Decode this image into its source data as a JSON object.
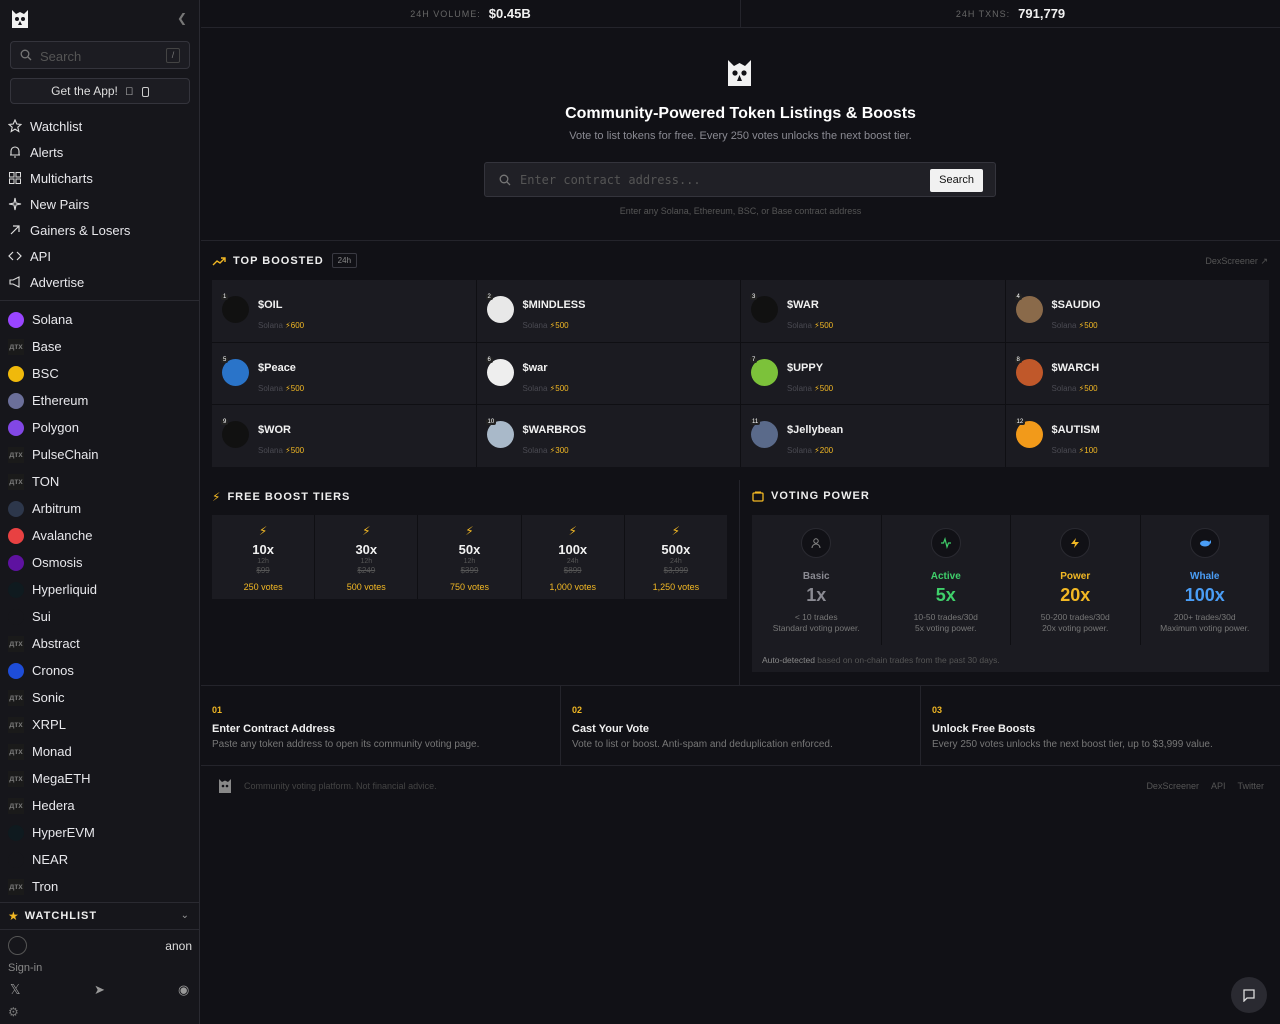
{
  "sidebar": {
    "search": {
      "placeholder": "Search",
      "kbd": "/"
    },
    "get_app": "Get the App!",
    "nav": [
      {
        "label": "Watchlist",
        "icon": "star-icon"
      },
      {
        "label": "Alerts",
        "icon": "bell-icon"
      },
      {
        "label": "Multicharts",
        "icon": "grid-icon"
      },
      {
        "label": "New Pairs",
        "icon": "sparkle-icon"
      },
      {
        "label": "Gainers & Losers",
        "icon": "arrow-up-right-icon"
      },
      {
        "label": "API",
        "icon": "code-icon"
      },
      {
        "label": "Advertise",
        "icon": "megaphone-icon"
      }
    ],
    "chains": [
      {
        "label": "Solana",
        "color": "#9945ff",
        "glyph": ""
      },
      {
        "label": "Base",
        "color": "#1a1a1a",
        "glyph": "дтх"
      },
      {
        "label": "BSC",
        "color": "#f0b90b",
        "glyph": ""
      },
      {
        "label": "Ethereum",
        "color": "#6b6f9a",
        "glyph": ""
      },
      {
        "label": "Polygon",
        "color": "#8247e5",
        "glyph": ""
      },
      {
        "label": "PulseChain",
        "color": "#1a1a1a",
        "glyph": "дтх"
      },
      {
        "label": "TON",
        "color": "#1a1a1a",
        "glyph": "дтх"
      },
      {
        "label": "Arbitrum",
        "color": "#2d374b",
        "glyph": ""
      },
      {
        "label": "Avalanche",
        "color": "#e84142",
        "glyph": ""
      },
      {
        "label": "Osmosis",
        "color": "#5e12a0",
        "glyph": ""
      },
      {
        "label": "Hyperliquid",
        "color": "#0f1a1f",
        "glyph": ""
      },
      {
        "label": "Sui",
        "color": "#16161b",
        "glyph": ""
      },
      {
        "label": "Abstract",
        "color": "#1a1a1a",
        "glyph": "дтх"
      },
      {
        "label": "Cronos",
        "color": "#1e4dd8",
        "glyph": ""
      },
      {
        "label": "Sonic",
        "color": "#1a1a1a",
        "glyph": "дтх"
      },
      {
        "label": "XRPL",
        "color": "#1a1a1a",
        "glyph": "дтх"
      },
      {
        "label": "Monad",
        "color": "#1a1a1a",
        "glyph": "дтх"
      },
      {
        "label": "MegaETH",
        "color": "#1a1a1a",
        "glyph": "дтх"
      },
      {
        "label": "Hedera",
        "color": "#1a1a1a",
        "glyph": "дтх"
      },
      {
        "label": "HyperEVM",
        "color": "#0f1a1f",
        "glyph": ""
      },
      {
        "label": "NEAR",
        "color": "#16161b",
        "glyph": ""
      },
      {
        "label": "Tron",
        "color": "#1a1a1a",
        "glyph": "дтх"
      }
    ],
    "watchlist_title": "WATCHLIST",
    "user_name": "anon",
    "sign_in": "Sign-in"
  },
  "stats": [
    {
      "label": "24H VOLUME:",
      "value": "$0.45B"
    },
    {
      "label": "24H TXNS:",
      "value": "791,779"
    }
  ],
  "hero": {
    "title": "Community-Powered Token Listings & Boosts",
    "subtitle": "Vote to list tokens for free. Every 250 votes unlocks the next boost tier.",
    "input_placeholder": "Enter contract address...",
    "search_button": "Search",
    "hint": "Enter any Solana, Ethereum, BSC, or Base contract address"
  },
  "top_boosted": {
    "title": "TOP BOOSTED",
    "pill": "24h",
    "link": "DexScreener",
    "tokens": [
      {
        "rank": "1",
        "symbol": "$OIL",
        "chain": "Solana",
        "boost": "600",
        "color": "#111"
      },
      {
        "rank": "2",
        "symbol": "$MINDLESS",
        "chain": "Solana",
        "boost": "500",
        "color": "#e8e8e8"
      },
      {
        "rank": "3",
        "symbol": "$WAR",
        "chain": "Solana",
        "boost": "500",
        "color": "#111"
      },
      {
        "rank": "4",
        "symbol": "$SAUDIO",
        "chain": "Solana",
        "boost": "500",
        "color": "#8a6a4a"
      },
      {
        "rank": "5",
        "symbol": "$Peace",
        "chain": "Solana",
        "boost": "500",
        "color": "#2a74c9"
      },
      {
        "rank": "6",
        "symbol": "$war",
        "chain": "Solana",
        "boost": "500",
        "color": "#eeeeee"
      },
      {
        "rank": "7",
        "symbol": "$UPPY",
        "chain": "Solana",
        "boost": "500",
        "color": "#7cc23a"
      },
      {
        "rank": "8",
        "symbol": "$WARCH",
        "chain": "Solana",
        "boost": "500",
        "color": "#c0582a"
      },
      {
        "rank": "9",
        "symbol": "$WOR",
        "chain": "Solana",
        "boost": "500",
        "color": "#111"
      },
      {
        "rank": "10",
        "symbol": "$WARBROS",
        "chain": "Solana",
        "boost": "300",
        "color": "#a9b9c9"
      },
      {
        "rank": "11",
        "symbol": "$Jellybean",
        "chain": "Solana",
        "boost": "200",
        "color": "#5a6a8a"
      },
      {
        "rank": "12",
        "symbol": "$AUTISM",
        "chain": "Solana",
        "boost": "100",
        "color": "#f29a1a"
      }
    ]
  },
  "free_boost": {
    "title": "FREE BOOST TIERS",
    "tiers": [
      {
        "mult": "10x",
        "dur": "12h",
        "price": "$99",
        "votes": "250 votes"
      },
      {
        "mult": "30x",
        "dur": "12h",
        "price": "$249",
        "votes": "500 votes"
      },
      {
        "mult": "50x",
        "dur": "12h",
        "price": "$399",
        "votes": "750 votes"
      },
      {
        "mult": "100x",
        "dur": "24h",
        "price": "$899",
        "votes": "1,000 votes"
      },
      {
        "mult": "500x",
        "dur": "24h",
        "price": "$3,999",
        "votes": "1,250 votes"
      }
    ]
  },
  "voting_power": {
    "title": "VOTING POWER",
    "levels": [
      {
        "name": "Basic",
        "mult": "1x",
        "d1": "< 10 trades",
        "d2": "Standard voting power.",
        "color": "#8a8a92",
        "icon": "user-icon"
      },
      {
        "name": "Active",
        "mult": "5x",
        "d1": "10-50 trades/30d",
        "d2": "5x voting power.",
        "color": "#3fcf6a",
        "icon": "activity-icon"
      },
      {
        "name": "Power",
        "mult": "20x",
        "d1": "50-200 trades/30d",
        "d2": "20x voting power.",
        "color": "#f2b824",
        "icon": "bolt-icon"
      },
      {
        "name": "Whale",
        "mult": "100x",
        "d1": "200+ trades/30d",
        "d2": "Maximum voting power.",
        "color": "#4a9df5",
        "icon": "whale-icon"
      }
    ],
    "footer_bold": "Auto-detected",
    "footer_rest": " based on on-chain trades from the past 30 days."
  },
  "steps": [
    {
      "num": "01",
      "title": "Enter Contract Address",
      "text": "Paste any token address to open its community voting page."
    },
    {
      "num": "02",
      "title": "Cast Your Vote",
      "text": "Vote to list or boost. Anti-spam and deduplication enforced."
    },
    {
      "num": "03",
      "title": "Unlock Free Boosts",
      "text": "Every 250 votes unlocks the next boost tier, up to $3,999 value."
    }
  ],
  "footer": {
    "text": "Community voting platform. Not financial advice.",
    "links": [
      "DexScreener",
      "API",
      "Twitter"
    ]
  }
}
